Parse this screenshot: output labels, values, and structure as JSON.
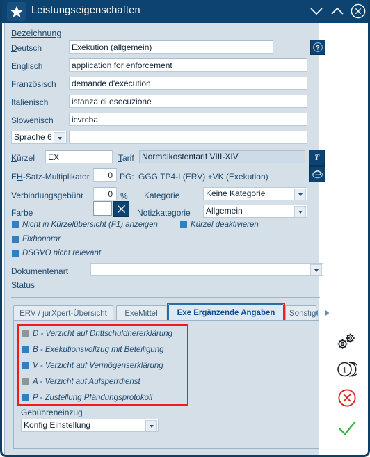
{
  "window": {
    "title": "Leistungseigenschaften",
    "icon": "star-icon",
    "buttons": {
      "minimize": "chevron-down-icon",
      "maximize": "chevron-up-icon",
      "close": "circle-close-icon"
    }
  },
  "form": {
    "group_label": "Bezeichnung",
    "languages": [
      {
        "label": "Deutsch",
        "accel": "D",
        "value": "Exekution (allgemein)"
      },
      {
        "label": "Englisch",
        "accel": "E",
        "value": "application for enforcement"
      },
      {
        "label": "Französisch",
        "accel": "",
        "value": "demande d'exécution"
      },
      {
        "label": "Italienisch",
        "accel": "",
        "value": "istanza di esecuzione"
      },
      {
        "label": "Slowenisch",
        "accel": "",
        "value": "icvrcba"
      }
    ],
    "language6": {
      "label": "Sprache 6",
      "value": ""
    },
    "help_button": "?",
    "kuerzel": {
      "label": "Kürzel",
      "accel": "K",
      "value": "EX"
    },
    "tarif": {
      "label": "Tarif",
      "accel": "T",
      "value": "Normalkostentarif VIII-XIV",
      "button": "T"
    },
    "eh_satz": {
      "label": "EH-Satz-Multiplikator",
      "accel": "H",
      "value": "0"
    },
    "pg": {
      "label": "PG:",
      "value": "GGG TP4-I (ERV) +VK (Exekution)",
      "button_icon": "browser-icon"
    },
    "verbindungsgebuehr": {
      "label": "Verbindungsgebühr",
      "value": "0",
      "unit": "%"
    },
    "kategorie": {
      "label": "Kategorie",
      "value": "Keine Kategorie"
    },
    "farbe": {
      "label": "Farbe",
      "value": "",
      "clear_button": "x-icon"
    },
    "notizkategorie": {
      "label": "Notizkategorie",
      "value": "Allgemein"
    },
    "options": [
      {
        "label": "Nicht in Kürzelübersicht (F1) anzeigen",
        "state": "checked"
      },
      {
        "label": "Kürzel deaktivieren",
        "state": "checked"
      },
      {
        "label": "Fixhonorar",
        "state": "checked"
      },
      {
        "label": "DSGVO nicht relevant",
        "state": "checked"
      }
    ],
    "dokumentenart": {
      "label": "Dokumentenart",
      "value": ""
    },
    "status": {
      "label": "Status",
      "value": ""
    }
  },
  "tabs": {
    "items": [
      {
        "label": "ERV / jurXpert-Übersicht",
        "active": false
      },
      {
        "label": "ExeMittel",
        "active": false
      },
      {
        "label": "Exe Ergänzende Angaben",
        "active": true
      },
      {
        "label": "Sonstig",
        "active": false
      }
    ],
    "scroll_left": "◀",
    "scroll_right": "▶"
  },
  "tab_page": {
    "checkboxes": [
      {
        "label": "D - Verzicht auf Drittschuldnererklärung",
        "state": "disabled"
      },
      {
        "label": "B - Exekutionsvollzug mit Beteiligung",
        "state": "checked"
      },
      {
        "label": "V - Verzicht auf Vermögenserklärung",
        "state": "checked"
      },
      {
        "label": "A - Verzicht auf Aufsperrdienst",
        "state": "disabled"
      },
      {
        "label": "P - Zustellung Pfändungsprotokoll",
        "state": "checked"
      }
    ],
    "gebuehreneinzug": {
      "label": "Gebühreneinzug",
      "value": "Konfig Einstellung"
    }
  },
  "side_actions": [
    {
      "name": "settings-gears-icon",
      "label": ""
    },
    {
      "name": "coins-stack-icon",
      "label": "1"
    },
    {
      "name": "cancel-circle-icon",
      "label": ""
    },
    {
      "name": "confirm-check-icon",
      "label": ""
    }
  ],
  "colors": {
    "title_bar": "#0d4370",
    "panel": "#d4dfe8",
    "accent": "#2f7fc4",
    "highlight": "#ee1c1c",
    "cancel": "#e02020",
    "confirm": "#39b54a"
  }
}
